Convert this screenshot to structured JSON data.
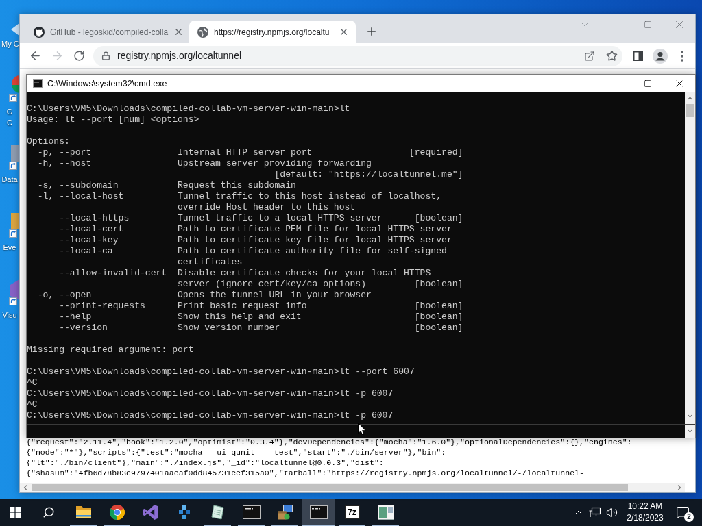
{
  "desktop": {
    "icons": [
      {
        "kind": "computer",
        "label_lines": [
          "My C"
        ]
      },
      {
        "kind": "browser",
        "label_lines": [
          "G",
          "C"
        ]
      },
      {
        "kind": "database",
        "label_lines": [
          "Data"
        ]
      },
      {
        "kind": "viewer",
        "label_lines": [
          "Eve"
        ]
      },
      {
        "kind": "ide",
        "label_lines": [
          "Visu"
        ]
      }
    ]
  },
  "browser": {
    "tabs": [
      {
        "kind": "github",
        "title": "GitHub - legoskid/compiled-colla",
        "selected": false
      },
      {
        "kind": "globe",
        "title": "https://registry.npmjs.org/localtu",
        "selected": true
      }
    ],
    "forward_disabled": true,
    "address": "registry.npmjs.org/localtunnel",
    "page_lines": [
      "{\"request\":\"2.11.4\",\"book\":\"1.2.0\",\"optimist\":\"0.3.4\"},\"devDependencies\":{\"mocha\":\"1.6.0\"},\"optionalDependencies\":{},\"engines\":",
      "{\"node\":\"*\"},\"scripts\":{\"test\":\"mocha --ui qunit -- test\",\"start\":\"./bin/server\"},\"bin\":",
      "{\"lt\":\"./bin/client\"},\"main\":\"./index.js\",\"_id\":\"localtunnel@0.0.3\",\"dist\":",
      "{\"shasum\":\"4fb6d78b83c9797401aaeaf0dd845731eef315a0\",\"tarball\":\"https://registry.npmjs.org/localtunnel/-/localtunnel-"
    ]
  },
  "terminal": {
    "title": "C:\\Windows\\system32\\cmd.exe",
    "sections": [
      {
        "items": [
          {
            "kind": "text",
            "text": "C:\\Users\\VM5\\Downloads\\compiled-collab-vm-server-win-main>lt"
          },
          {
            "kind": "text",
            "text": "Usage: lt --port [num] <options>"
          }
        ]
      },
      {
        "items": [
          {
            "kind": "text",
            "text": "Options:"
          },
          {
            "kind": "option",
            "short": "-p,",
            "long": "--port",
            "description": [
              "Internal HTTP server port"
            ],
            "note": "[required]"
          },
          {
            "kind": "option",
            "short": "-h,",
            "long": "--host",
            "description": [
              "Upstream server providing forwarding"
            ],
            "note": "[default: \"https://localtunnel.me\"]"
          },
          {
            "kind": "option",
            "short": "-s,",
            "long": "--subdomain",
            "description": [
              "Request this subdomain"
            ]
          },
          {
            "kind": "option",
            "short": "-l,",
            "long": "--local-host",
            "description": [
              "Tunnel traffic to this host instead of localhost,",
              "override Host header to this host"
            ]
          },
          {
            "kind": "option",
            "long": "--local-https",
            "description": [
              "Tunnel traffic to a local HTTPS server"
            ],
            "note": "[boolean]"
          },
          {
            "kind": "option",
            "long": "--local-cert",
            "description": [
              "Path to certificate PEM file for local HTTPS server"
            ]
          },
          {
            "kind": "option",
            "long": "--local-key",
            "description": [
              "Path to certificate key file for local HTTPS server"
            ]
          },
          {
            "kind": "option",
            "long": "--local-ca",
            "description": [
              "Path to certificate authority file for self-signed",
              "certificates"
            ]
          },
          {
            "kind": "option",
            "long": "--allow-invalid-cert",
            "description": [
              "Disable certificate checks for your local HTTPS",
              "server (ignore cert/key/ca options)"
            ],
            "note": "[boolean]"
          },
          {
            "kind": "option",
            "short": "-o,",
            "long": "--open",
            "description": [
              "Opens the tunnel URL in your browser"
            ]
          },
          {
            "kind": "option",
            "long": "--print-requests",
            "description": [
              "Print basic request info"
            ],
            "note": "[boolean]"
          },
          {
            "kind": "option",
            "long": "--help",
            "description": [
              "Show this help and exit"
            ],
            "note": "[boolean]"
          },
          {
            "kind": "option",
            "long": "--version",
            "description": [
              "Show version number"
            ],
            "note": "[boolean]"
          }
        ]
      },
      {
        "items": [
          {
            "kind": "text",
            "text": "Missing required argument: port"
          }
        ]
      },
      {
        "items": [
          {
            "kind": "text",
            "text": "C:\\Users\\VM5\\Downloads\\compiled-collab-vm-server-win-main>lt --port 6007"
          },
          {
            "kind": "text",
            "text": "^C"
          },
          {
            "kind": "text",
            "text": "C:\\Users\\VM5\\Downloads\\compiled-collab-vm-server-win-main>lt -p 6007"
          },
          {
            "kind": "text",
            "text": "^C"
          },
          {
            "kind": "text",
            "text": "C:\\Users\\VM5\\Downloads\\compiled-collab-vm-server-win-main>lt -p 6007"
          }
        ]
      }
    ]
  },
  "taskbar": {
    "apps": [
      {
        "kind": "explorer",
        "running": true,
        "selected": false
      },
      {
        "kind": "chrome",
        "running": true,
        "selected": false
      },
      {
        "kind": "vs",
        "running": false,
        "selected": false
      },
      {
        "kind": "cubes",
        "running": false,
        "selected": false
      },
      {
        "kind": "notepad",
        "running": true,
        "selected": false
      },
      {
        "kind": "console",
        "running": true,
        "selected": false
      },
      {
        "kind": "installer",
        "running": true,
        "selected": false
      },
      {
        "kind": "console",
        "running": true,
        "selected": true
      },
      {
        "kind": "archiver",
        "glyph": "7z",
        "running": true,
        "selected": false
      },
      {
        "kind": "window",
        "running": true,
        "selected": false
      }
    ],
    "time": "10:22 AM",
    "date": "2/18/2023",
    "notification_count": "2"
  }
}
